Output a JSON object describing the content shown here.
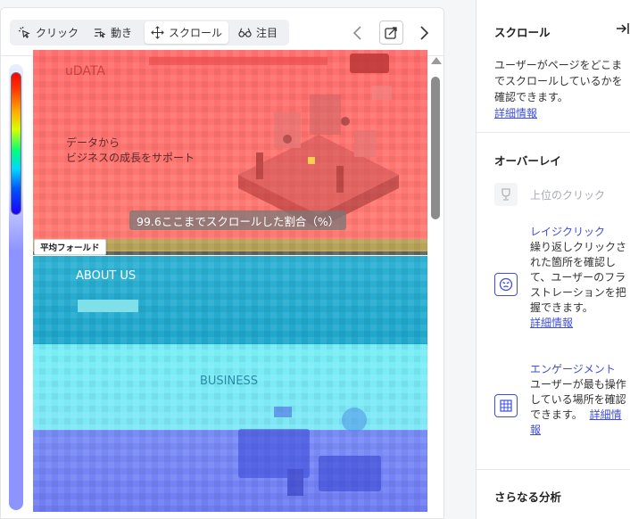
{
  "toolbar": {
    "modes": [
      {
        "label": "クリック",
        "icon": "click-icon"
      },
      {
        "label": "動き",
        "icon": "mouse-move-icon"
      },
      {
        "label": "スクロール",
        "icon": "scroll-icon",
        "active": true
      },
      {
        "label": "注目",
        "icon": "glasses-icon"
      }
    ]
  },
  "heatmap": {
    "scroll_label": "99.6ここまでスクロールした割合（%）",
    "fold_label": "平均フォールド",
    "scroll_percent": 99.6,
    "page_text": {
      "logo": "uDATA",
      "hero_line1": "データから",
      "hero_line2": "ビジネスの成長をサポート",
      "about_title": "ABOUT US",
      "business_title": "BUSINESS"
    },
    "colors": {
      "top": "#ff6b6b",
      "fold": "#b4b45a",
      "mid": "#23b4d2",
      "cyan": "#78f0f5",
      "low": "#7d87f5"
    }
  },
  "sidebar": {
    "title": "スクロール",
    "description": "ユーザーがページをどこまでスクロールしているかを確認できます。",
    "details_link": "詳細情報",
    "overlay_title": "オーバーレイ",
    "overlay_items": [
      {
        "title": "上位のクリック",
        "icon": "trophy-icon",
        "disabled": true
      },
      {
        "title": "レイジクリック",
        "description": "繰り返しクリックされた箇所を確認して、ユーザーのフラストレーションを把握できます。",
        "link": "詳細情報",
        "icon": "angry-face-icon"
      },
      {
        "title": "エンゲージメント",
        "description": "ユーザーが最も操作している場所を確認できます。",
        "link": "詳細情報",
        "icon": "grid-icon"
      }
    ],
    "more_title": "さらなる分析"
  }
}
